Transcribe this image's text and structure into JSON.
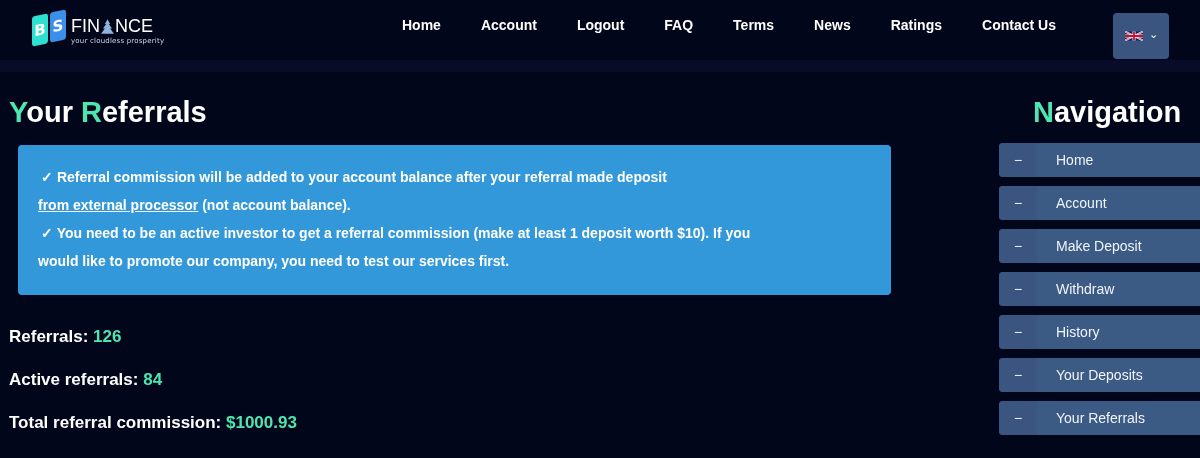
{
  "header": {
    "logo": {
      "letters": [
        "B",
        "S"
      ],
      "name_start": "FIN",
      "name_end": "NCE",
      "tagline": "your cloudless prosperity"
    },
    "menu": [
      {
        "label": "Home"
      },
      {
        "label": "Account"
      },
      {
        "label": "Logout"
      },
      {
        "label": "FAQ"
      },
      {
        "label": "Terms"
      },
      {
        "label": "News"
      },
      {
        "label": "Ratings"
      },
      {
        "label": "Contact Us"
      }
    ],
    "language": {
      "caret": "⌄"
    }
  },
  "page_title": [
    {
      "initial": "Y",
      "rest": "our"
    },
    {
      "initial": "R",
      "rest": "eferrals"
    }
  ],
  "notice": [
    {
      "check": "✓",
      "before": "Referral commission will be added to your account balance after your referral made deposit ",
      "link": "from external processor",
      "after": " (not account balance)."
    },
    {
      "check": "✓",
      "before": "You need to be an active investor to get a referral commission (make at least 1 deposit worth $10). If you would like to promote our company, you need to test our services first."
    }
  ],
  "stats": [
    {
      "label": "Referrals:",
      "value": "126"
    },
    {
      "label": "Active referrals:",
      "value": "84"
    },
    {
      "label": "Total referral commission:",
      "value": "$1000.93"
    }
  ],
  "navigation": {
    "title": {
      "initial": "N",
      "rest": "avigation"
    },
    "items": [
      {
        "marker": "−",
        "label": "Home"
      },
      {
        "marker": "−",
        "label": "Account"
      },
      {
        "marker": "−",
        "label": "Make Deposit"
      },
      {
        "marker": "−",
        "label": "Withdraw"
      },
      {
        "marker": "−",
        "label": "History"
      },
      {
        "marker": "−",
        "label": "Your Deposits"
      },
      {
        "marker": "−",
        "label": "Your Referrals"
      }
    ]
  }
}
